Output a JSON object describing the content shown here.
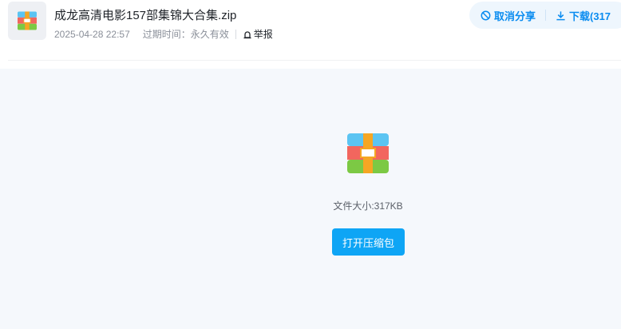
{
  "file": {
    "title": "成龙高清电影157部集锦大合集.zip",
    "date": "2025-04-28 22:57",
    "expiry_label": "过期时间：永久有效",
    "report_label": "举报",
    "icon": "zip-archive-icon"
  },
  "actions": {
    "cancel_share_label": "取消分享",
    "download_label": "下载(317"
  },
  "main": {
    "file_size": "文件大小:317KB",
    "open_button": "打开压缩包"
  },
  "colors": {
    "accent": "#0a8cf0",
    "button": "#0ea5f5",
    "background": "#f5f8fc"
  }
}
